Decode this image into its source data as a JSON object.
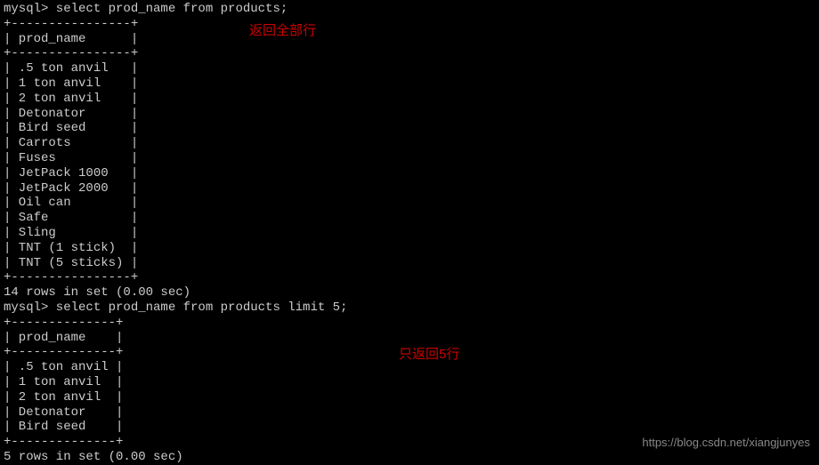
{
  "q1": {
    "prompt": "mysql> select prod_name from products;",
    "sep": "+----------------+",
    "header": "| prod_name      |",
    "rows": [
      "| .5 ton anvil   |",
      "| 1 ton anvil    |",
      "| 2 ton anvil    |",
      "| Detonator      |",
      "| Bird seed      |",
      "| Carrots        |",
      "| Fuses          |",
      "| JetPack 1000   |",
      "| JetPack 2000   |",
      "| Oil can        |",
      "| Safe           |",
      "| Sling          |",
      "| TNT (1 stick)  |",
      "| TNT (5 sticks) |"
    ],
    "footer": "14 rows in set (0.00 sec)"
  },
  "q2": {
    "prompt": "mysql> select prod_name from products limit 5;",
    "sep": "+--------------+",
    "header": "| prod_name    |",
    "rows": [
      "| .5 ton anvil |",
      "| 1 ton anvil  |",
      "| 2 ton anvil  |",
      "| Detonator    |",
      "| Bird seed    |"
    ],
    "footer": "5 rows in set (0.00 sec)"
  },
  "blank": "",
  "annotations": {
    "all_rows": "返回全部行",
    "five_rows": "只返回5行"
  },
  "watermark": "https://blog.csdn.net/xiangjunyes",
  "chart_data": {
    "type": "table",
    "query1": {
      "sql": "select prod_name from products;",
      "columns": [
        "prod_name"
      ],
      "rows": [
        ".5 ton anvil",
        "1 ton anvil",
        "2 ton anvil",
        "Detonator",
        "Bird seed",
        "Carrots",
        "Fuses",
        "JetPack 1000",
        "JetPack 2000",
        "Oil can",
        "Safe",
        "Sling",
        "TNT (1 stick)",
        "TNT (5 sticks)"
      ],
      "row_count": 14,
      "time_sec": 0.0
    },
    "query2": {
      "sql": "select prod_name from products limit 5;",
      "columns": [
        "prod_name"
      ],
      "rows": [
        ".5 ton anvil",
        "1 ton anvil",
        "2 ton anvil",
        "Detonator",
        "Bird seed"
      ],
      "row_count": 5,
      "time_sec": 0.0
    }
  }
}
